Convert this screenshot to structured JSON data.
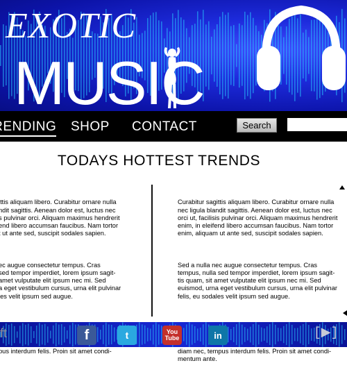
{
  "brand": {
    "top": "EXOTIC",
    "main": "MUSIC"
  },
  "nav": {
    "items": [
      {
        "label": "TRENDING",
        "active": true
      },
      {
        "label": "SHOP",
        "active": false
      },
      {
        "label": "CONTACT",
        "active": false
      }
    ],
    "search_label": "Search",
    "search_value": ""
  },
  "content": {
    "heading": "TODAYS HOTTEST TRENDS",
    "left_column": [
      "ittis aliquam libero. Curabitur ornare nulla\nndit sagittis. Aenean dolor est, luctus nec\ns pulvinar orci. Aliquam maximus hendrerit\nend libero accumsan faucibus. Nam tortor\nt ut ante sed, suscipit sodales sapien.",
      "ec augue consectetur tempus. Cras\nsed tempor imperdiet, lorem ipsum sagit-\namet vulputate elit ipsum nec mi. Sed\na eget vestibulum cursus, urna elit pulvinar\nles velit ipsum sed augue.",
      "ue nulla massa. Duis fringilla nibh vitae\nac eleifend nisi luctus. Nullam ornare nulla\nus. Sed orci lorem, fermentum sit amet\npus interdum felis. Proin sit amet condi-"
    ],
    "right_column": [
      "Curabitur sagittis aliquam libero. Curabitur ornare nulla\nnec ligula blandit sagittis. Aenean dolor est, luctus nec\norci ut, facilisis pulvinar orci. Aliquam maximus hendrerit\nenim, in eleifend libero accumsan faucibus. Nam tortor\nenim, aliquam ut ante sed, suscipit sodales sapien.",
      "Sed a nulla nec augue consectetur tempus. Cras\ntempus, nulla sed tempor imperdiet, lorem ipsum sagit-\ntis quam, sit amet vulputate elit ipsum nec mi. Sed\neuismod, urna eget vestibulum cursus, urna elit pulvinar\nfelis, eu sodales velit ipsum sed augue.",
      "Quisque tristique nulla massa. Duis fringilla nibh vitae\nelit pharetra, ac eleifend nisi luctus. Nullam ornare nulla\na congue tempor. Sed orci lorem, fermentum sit amet\ndiam nec, tempus interdum felis. Proin sit amet condi-\nmentum ante."
    ]
  },
  "footer": {
    "left_text": "ft",
    "social": [
      {
        "icon": "facebook-icon",
        "glyph": "f"
      },
      {
        "icon": "twitter-icon",
        "glyph": "t"
      },
      {
        "icon": "youtube-icon",
        "glyph_top": "You",
        "glyph_bottom": "Tube"
      },
      {
        "icon": "linkedin-icon",
        "glyph": "in"
      }
    ],
    "right_logo": "[▶]"
  },
  "colors": {
    "banner": "#1d2bdc",
    "nav": "#000000",
    "footer": "#1728d6",
    "facebook": "#3b5998",
    "twitter": "#2aa9e0",
    "youtube": "#c4302b",
    "linkedin": "#0e76a8"
  }
}
